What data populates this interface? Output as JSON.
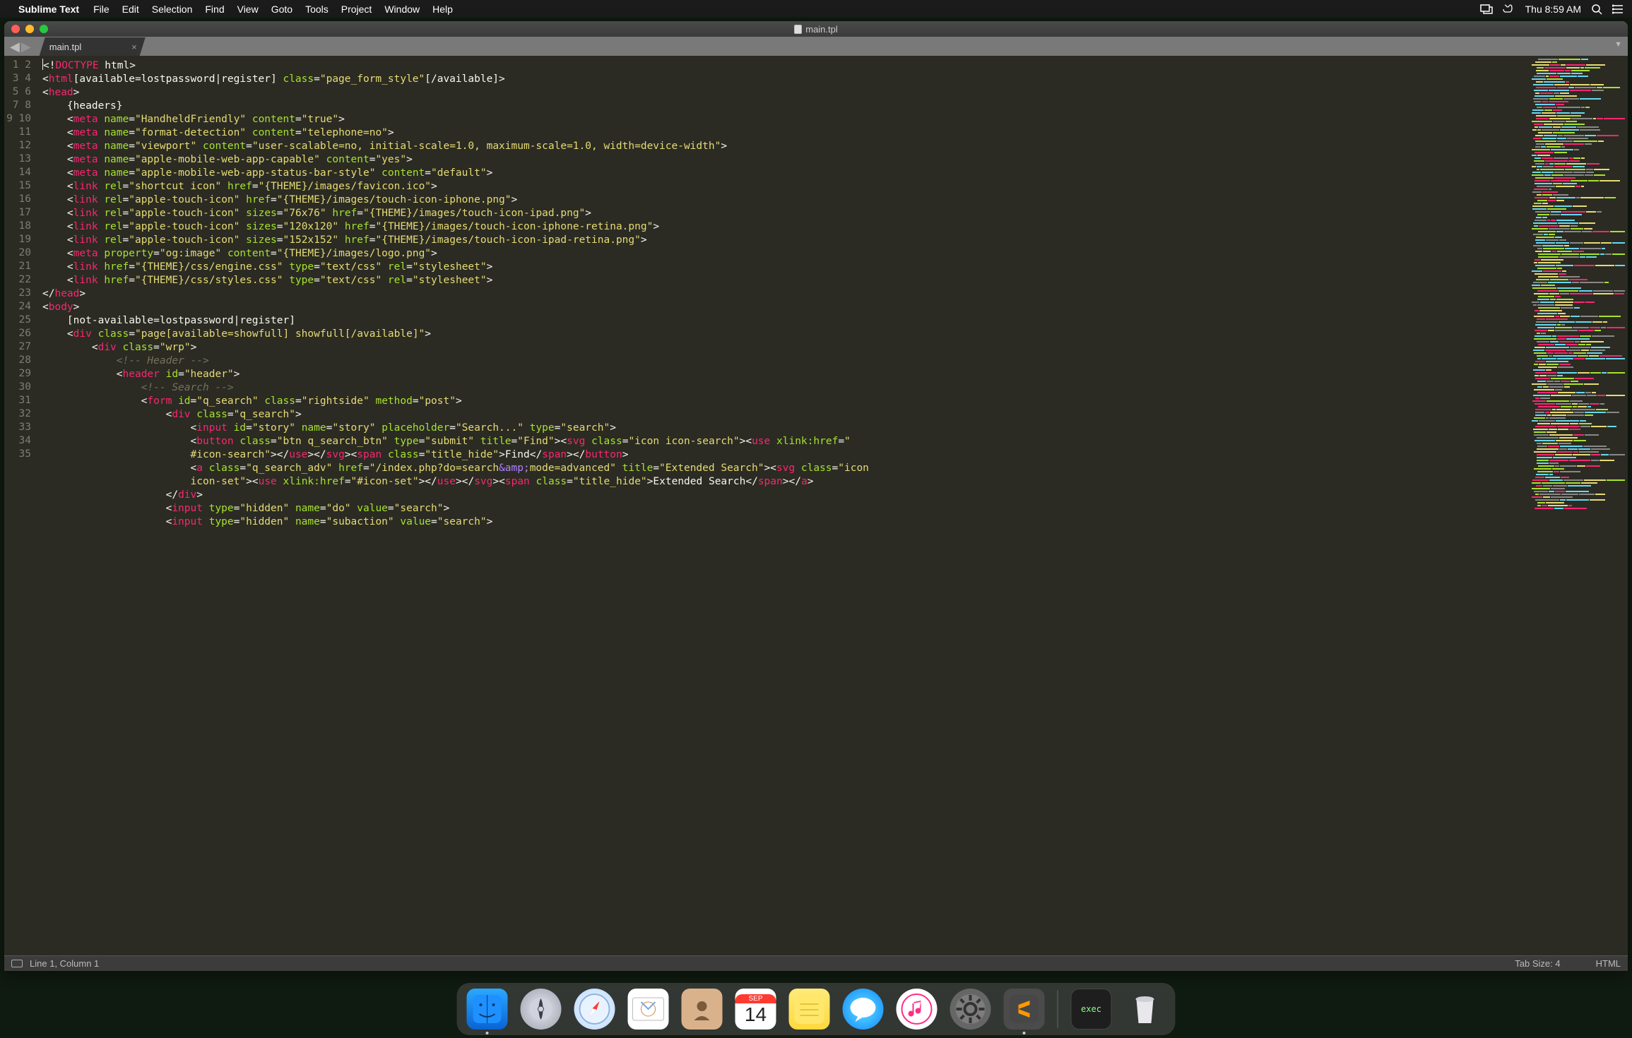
{
  "menubar": {
    "app": "Sublime Text",
    "items": [
      "File",
      "Edit",
      "Selection",
      "Find",
      "View",
      "Goto",
      "Tools",
      "Project",
      "Window",
      "Help"
    ],
    "clock": "Thu 8:59 AM"
  },
  "window": {
    "title": "main.tpl",
    "tab": "main.tpl"
  },
  "status": {
    "cursor": "Line 1, Column 1",
    "tabsize": "Tab Size: 4",
    "syntax": "HTML"
  },
  "dock": {
    "cal_month": "SEP",
    "cal_day": "14",
    "term": "exec"
  },
  "code": {
    "l1": {
      "a": "<!",
      "b": "DOCTYPE",
      "c": " html",
      "d": ">"
    },
    "l2": {
      "a": "<",
      "b": "html",
      "c": "[available=lostpassword|register] ",
      "d": "class",
      "e": "=",
      "f": "\"page_form_style\"",
      "g": "[/available]",
      "h": ">"
    },
    "l3": {
      "a": "<",
      "b": "head",
      "c": ">"
    },
    "l4": "    {headers}",
    "l5": {
      "a": "    <",
      "b": "meta",
      "c": " ",
      "d": "name",
      "e": "=",
      "f": "\"HandheldFriendly\"",
      "g": " ",
      "h": "content",
      "i": "=",
      "j": "\"true\"",
      "k": ">"
    },
    "l6": {
      "a": "    <",
      "b": "meta",
      "c": " ",
      "d": "name",
      "e": "=",
      "f": "\"format-detection\"",
      "g": " ",
      "h": "content",
      "i": "=",
      "j": "\"telephone=no\"",
      "k": ">"
    },
    "l7": {
      "a": "    <",
      "b": "meta",
      "c": " ",
      "d": "name",
      "e": "=",
      "f": "\"viewport\"",
      "g": " ",
      "h": "content",
      "i": "=",
      "j": "\"user-scalable=no, initial-scale=1.0, maximum-scale=1.0, width=device-width\"",
      "k": ">"
    },
    "l8": {
      "a": "    <",
      "b": "meta",
      "c": " ",
      "d": "name",
      "e": "=",
      "f": "\"apple-mobile-web-app-capable\"",
      "g": " ",
      "h": "content",
      "i": "=",
      "j": "\"yes\"",
      "k": ">"
    },
    "l9": {
      "a": "    <",
      "b": "meta",
      "c": " ",
      "d": "name",
      "e": "=",
      "f": "\"apple-mobile-web-app-status-bar-style\"",
      "g": " ",
      "h": "content",
      "i": "=",
      "j": "\"default\"",
      "k": ">"
    },
    "l11": {
      "a": "    <",
      "b": "link",
      "c": " ",
      "d": "rel",
      "e": "=",
      "f": "\"shortcut icon\"",
      "g": " ",
      "h": "href",
      "i": "=",
      "j": "\"{THEME}/images/favicon.ico\"",
      "k": ">"
    },
    "l12": {
      "a": "    <",
      "b": "link",
      "c": " ",
      "d": "rel",
      "e": "=",
      "f": "\"apple-touch-icon\"",
      "g": " ",
      "h": "href",
      "i": "=",
      "j": "\"{THEME}/images/touch-icon-iphone.png\"",
      "k": ">"
    },
    "l13": {
      "a": "    <",
      "b": "link",
      "c": " ",
      "d": "rel",
      "e": "=",
      "f": "\"apple-touch-icon\"",
      "g": " ",
      "h": "sizes",
      "i": "=",
      "j": "\"76x76\"",
      "k": " ",
      "l": "href",
      "m": "=",
      "n": "\"{THEME}/images/touch-icon-ipad.png\"",
      "o": ">"
    },
    "l14": {
      "a": "    <",
      "b": "link",
      "c": " ",
      "d": "rel",
      "e": "=",
      "f": "\"apple-touch-icon\"",
      "g": " ",
      "h": "sizes",
      "i": "=",
      "j": "\"120x120\"",
      "k": " ",
      "l": "href",
      "m": "=",
      "n": "\"{THEME}/images/touch-icon-iphone-retina.png\"",
      "o": ">"
    },
    "l15": {
      "a": "    <",
      "b": "link",
      "c": " ",
      "d": "rel",
      "e": "=",
      "f": "\"apple-touch-icon\"",
      "g": " ",
      "h": "sizes",
      "i": "=",
      "j": "\"152x152\"",
      "k": " ",
      "l": "href",
      "m": "=",
      "n": "\"{THEME}/images/touch-icon-ipad-retina.png\"",
      "o": ">"
    },
    "l16": {
      "a": "    <",
      "b": "meta",
      "c": " ",
      "d": "property",
      "e": "=",
      "f": "\"og:image\"",
      "g": " ",
      "h": "content",
      "i": "=",
      "j": "\"{THEME}/images/logo.png\"",
      "k": ">"
    },
    "l18": {
      "a": "    <",
      "b": "link",
      "c": " ",
      "d": "href",
      "e": "=",
      "f": "\"{THEME}/css/engine.css\"",
      "g": " ",
      "h": "type",
      "i": "=",
      "j": "\"text/css\"",
      "k": " ",
      "l": "rel",
      "m": "=",
      "n": "\"stylesheet\"",
      "o": ">"
    },
    "l19": {
      "a": "    <",
      "b": "link",
      "c": " ",
      "d": "href",
      "e": "=",
      "f": "\"{THEME}/css/styles.css\"",
      "g": " ",
      "h": "type",
      "i": "=",
      "j": "\"text/css\"",
      "k": " ",
      "l": "rel",
      "m": "=",
      "n": "\"stylesheet\"",
      "o": ">"
    },
    "l20": {
      "a": "</",
      "b": "head",
      "c": ">"
    },
    "l21": {
      "a": "<",
      "b": "body",
      "c": ">"
    },
    "l22": "    [not-available=lostpassword|register]",
    "l23": {
      "a": "    <",
      "b": "div",
      "c": " ",
      "d": "class",
      "e": "=",
      "f": "\"page[available=showfull] showfull[/available]\"",
      "g": ">"
    },
    "l24": {
      "a": "        <",
      "b": "div",
      "c": " ",
      "d": "class",
      "e": "=",
      "f": "\"wrp\"",
      "g": ">"
    },
    "l25": "            <!-- Header -->",
    "l26": {
      "a": "            <",
      "b": "header",
      "c": " ",
      "d": "id",
      "e": "=",
      "f": "\"header\"",
      "g": ">"
    },
    "l27": "                <!-- Search -->",
    "l28": {
      "a": "                <",
      "b": "form",
      "c": " ",
      "d": "id",
      "e": "=",
      "f": "\"q_search\"",
      "g": " ",
      "h": "class",
      "i": "=",
      "j": "\"rightside\"",
      "k": " ",
      "l": "method",
      "m": "=",
      "n": "\"post\"",
      "o": ">"
    },
    "l29": {
      "a": "                    <",
      "b": "div",
      "c": " ",
      "d": "class",
      "e": "=",
      "f": "\"q_search\"",
      "g": ">"
    },
    "l30": {
      "a": "                        <",
      "b": "input",
      "c": " ",
      "d": "id",
      "e": "=",
      "f": "\"story\"",
      "g": " ",
      "h": "name",
      "i": "=",
      "j": "\"story\"",
      "k": " ",
      "l": "placeholder",
      "m": "=",
      "n": "\"Search...\"",
      "o": " ",
      "p": "type",
      "q": "=",
      "r": "\"search\"",
      "s": ">"
    },
    "l31a": {
      "a": "                        <",
      "b": "button",
      "c": " ",
      "d": "class",
      "e": "=",
      "f": "\"btn q_search_btn\"",
      "g": " ",
      "h": "type",
      "i": "=",
      "j": "\"submit\"",
      "k": " ",
      "l": "title",
      "m": "=",
      "n": "\"Find\"",
      "o": "><",
      "p": "svg",
      "q": " ",
      "r": "class",
      "s": "=",
      "t": "\"icon icon-search\"",
      "u": "><",
      "v": "use",
      "w": " ",
      "x": "xlink:href",
      "y": "=",
      "z": "\""
    },
    "l31b": {
      "a": "                        #icon-search\"",
      "b": "></",
      "c": "use",
      "d": "></",
      "e": "svg",
      "f": "><",
      "g": "span",
      "h": " ",
      "i": "class",
      "j": "=",
      "k": "\"title_hide\"",
      "l": ">",
      "m": "Find",
      "n": "</",
      "o": "span",
      "p": "></",
      "q": "button",
      "r": ">"
    },
    "l32a": {
      "a": "                        <",
      "b": "a",
      "c": " ",
      "d": "class",
      "e": "=",
      "f": "\"q_search_adv\"",
      "g": " ",
      "h": "href",
      "i": "=",
      "j": "\"/index.php?do=search",
      "k": "&amp;",
      "l": "mode=advanced\"",
      "m": " ",
      "n": "title",
      "o": "=",
      "p": "\"Extended Search\"",
      "q": "><",
      "r": "svg",
      "s": " ",
      "t": "class",
      "u": "=",
      "v": "\"icon "
    },
    "l32b": {
      "a": "                        icon-set\"",
      "b": "><",
      "c": "use",
      "d": " ",
      "e": "xlink:href",
      "f": "=",
      "g": "\"#icon-set\"",
      "h": "></",
      "i": "use",
      "j": "></",
      "k": "svg",
      "l": "><",
      "m": "span",
      "n": " ",
      "o": "class",
      "p": "=",
      "q": "\"title_hide\"",
      "r": ">",
      "s": "Extended Search",
      "t": "</",
      "u": "span",
      "v": "></",
      "w": "a",
      "x": ">"
    },
    "l33": {
      "a": "                    </",
      "b": "div",
      "c": ">"
    },
    "l34": {
      "a": "                    <",
      "b": "input",
      "c": " ",
      "d": "type",
      "e": "=",
      "f": "\"hidden\"",
      "g": " ",
      "h": "name",
      "i": "=",
      "j": "\"do\"",
      "k": " ",
      "l": "value",
      "m": "=",
      "n": "\"search\"",
      "o": ">"
    },
    "l35": {
      "a": "                    <",
      "b": "input",
      "c": " ",
      "d": "type",
      "e": "=",
      "f": "\"hidden\"",
      "g": " ",
      "h": "name",
      "i": "=",
      "j": "\"subaction\"",
      "k": " ",
      "l": "value",
      "m": "=",
      "n": "\"search\"",
      "o": ">"
    }
  }
}
